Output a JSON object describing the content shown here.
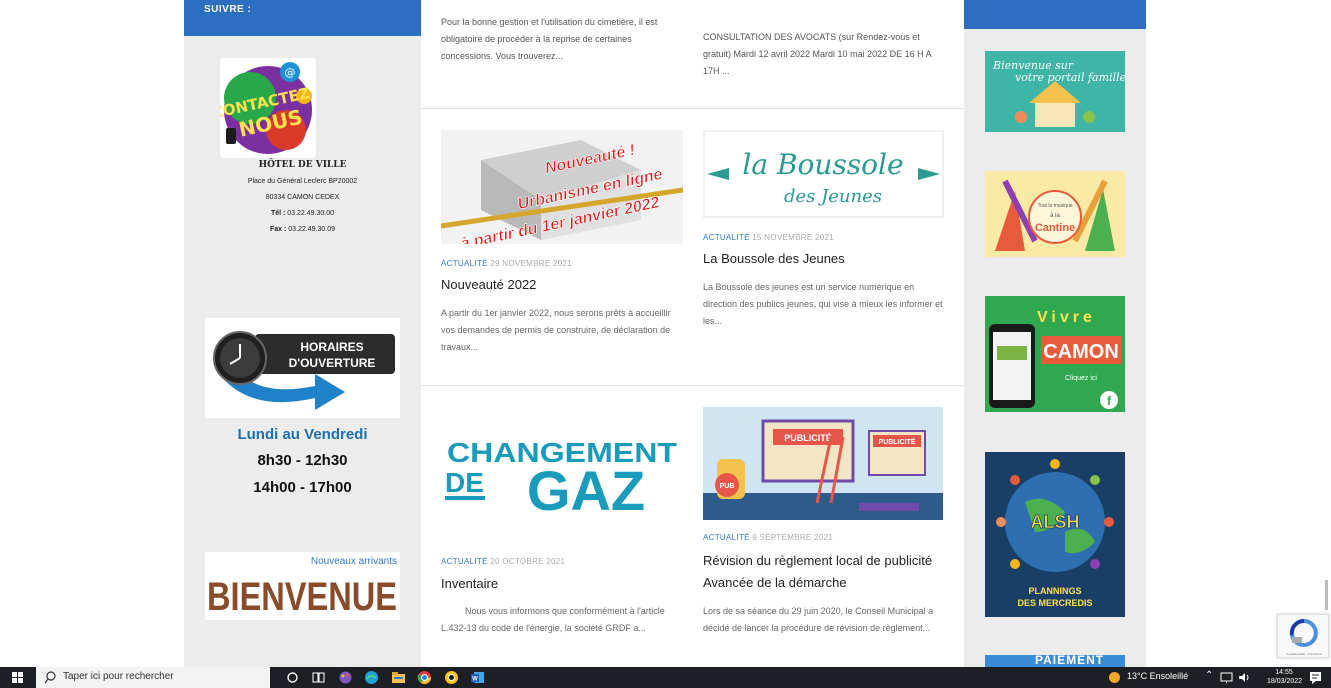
{
  "left_sidebar": {
    "header": "SUIVRE :",
    "contact_logo": {
      "line1": "CONTACTEZ",
      "line2": "NOUS"
    },
    "hotel": {
      "title": "HÔTEL DE VILLE",
      "address1": "Place du Général Leclerc BP20002",
      "address2": "80334 CAMON CEDEX",
      "tel_label": "Tél :",
      "tel": " 03.22.49.30.00",
      "fax_label": "Fax :",
      "fax": " 03.22.49.30.09"
    },
    "horaires": {
      "line1": "HORAIRES",
      "line2": "D'OUVERTURE"
    },
    "days": "Lundi au Vendredi",
    "morning": "8h30 - 12h30",
    "afternoon": "14h00 - 17h00",
    "bienvenue": {
      "top": "Nouveaux arrivants",
      "main": "BIENVENUE"
    }
  },
  "main": {
    "top_left_snippet": "Pour la bonne gestion et l'utilisation du cimetière, il est obligatoire de procéder à la reprise de certaines concessions. Vous trouverez...",
    "top_right_snippet": "CONSULTATION DES AVOCATS (sur Rendez-vous et gratuit) Mardi 12 avril 2022 Mardi 10 mai 2022 DE 16 H A 17H ...",
    "articles": [
      {
        "category": "ACTUALITÉ",
        "date": "29 NOVEMBRE 2021",
        "title": "Nouveauté 2022",
        "excerpt": "A partir du 1er janvier 2022, nous serons prêts à accueillir vos demandes de permis de construire, de déclaration de travaux...",
        "thumb": {
          "line1": "Nouveauté !",
          "line2": "Urbanisme en ligne",
          "line3": "à partir du 1er janvier 2022"
        }
      },
      {
        "category": "ACTUALITÉ",
        "date": "15 NOVEMBRE 2021",
        "title": "La Boussole des Jeunes",
        "excerpt": "La Boussole des jeunes est un service numérique en direction des publics jeunes, qui vise à mieux les informer et les...",
        "thumb": {
          "line1": "la Boussole",
          "line2": "des Jeunes"
        }
      },
      {
        "category": "ACTUALITÉ",
        "date": "20 OCTOBRE 2021",
        "title": "Inventaire",
        "excerpt": "Nous vous informons que conformément à l'article L.432-13 du code de l'énergie, la société GRDF a...",
        "thumb": {
          "line1": "CHANGEMENT",
          "line2": "DE",
          "line3": "GAZ"
        }
      },
      {
        "category": "ACTUALITÉ",
        "date": "9 SEPTEMBRE 2021",
        "title": "Révision du règlement local de publicité Avancée de la démarche",
        "excerpt": "Lors de sa séance du 29 juin 2020, le Conseil Municipal a décidé de lancer la procédure de révision de règlement...",
        "thumb": {
          "board1": "PUBLICITÉ",
          "board2": "PUBLICITÉ",
          "pub": "PUB"
        }
      }
    ]
  },
  "right_sidebar": {
    "portail": {
      "line1": "Bienvenue sur",
      "line2": "votre portail famille"
    },
    "cantine": {
      "line1": "Tout la musique",
      "line2": "à la",
      "line3": "Cantine"
    },
    "vivre": {
      "word1": "Vivre",
      "word2": "CAMON",
      "cta": "Cliquez ici"
    },
    "alsh": {
      "title": "ALSH",
      "line1": "PLANNINGS",
      "line2": "DES MERCREDIS"
    },
    "paiement": "PAIEMENT"
  },
  "recaptcha": {
    "footer": "Confidentialité - Conditions"
  },
  "taskbar": {
    "search_placeholder": "Taper ici pour rechercher",
    "weather": "13°C  Ensoleillé",
    "time": "14:55",
    "date": "18/03/2022"
  },
  "colors": {
    "accent_blue": "#2c6fc0",
    "category_blue": "#2f79c7",
    "sidebar_gray": "#ececec"
  }
}
